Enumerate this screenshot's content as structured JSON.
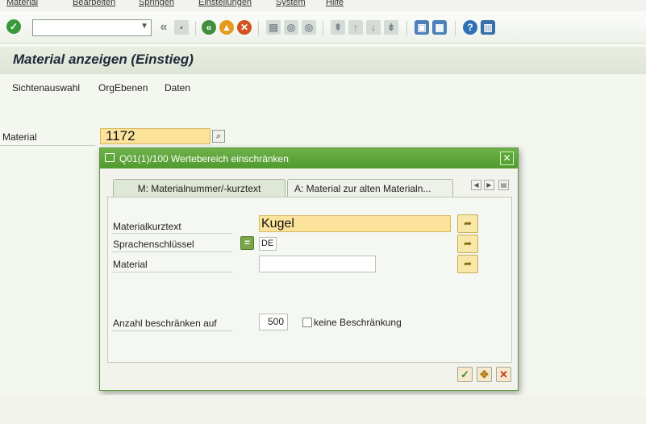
{
  "menu": [
    "Material",
    "Bearbeiten",
    "Springen",
    "Einstellungen",
    "System",
    "Hilfe"
  ],
  "toolbar": {
    "command_value": "",
    "back_glyph": "«"
  },
  "title": "Material anzeigen (Einstieg)",
  "app_toolbar": [
    "Sichtenauswahl",
    "OrgEbenen",
    "Daten"
  ],
  "main": {
    "material_label": "Material",
    "material_value": "1172"
  },
  "dialog": {
    "title": "Q01(1)/100 Wertebereich einschränken",
    "tabs": [
      "M: Materialnummer/-kurztext",
      "A: Material zur alten Materialn..."
    ],
    "fields": {
      "kurztext_label": "Materialkurztext",
      "kurztext_value": "Kugel",
      "sprache_label": "Sprachenschlüssel",
      "sprache_op": "=",
      "sprache_value": "DE",
      "material_label": "Material",
      "material_value": ""
    },
    "limit": {
      "label": "Anzahl beschränken auf",
      "value": "500",
      "no_limit_label": "keine Beschränkung",
      "no_limit_checked": false
    }
  },
  "colors": {
    "header_green": "#5aa538",
    "required_yellow": "#fbe39b",
    "title_dark": "#1e2a37"
  }
}
